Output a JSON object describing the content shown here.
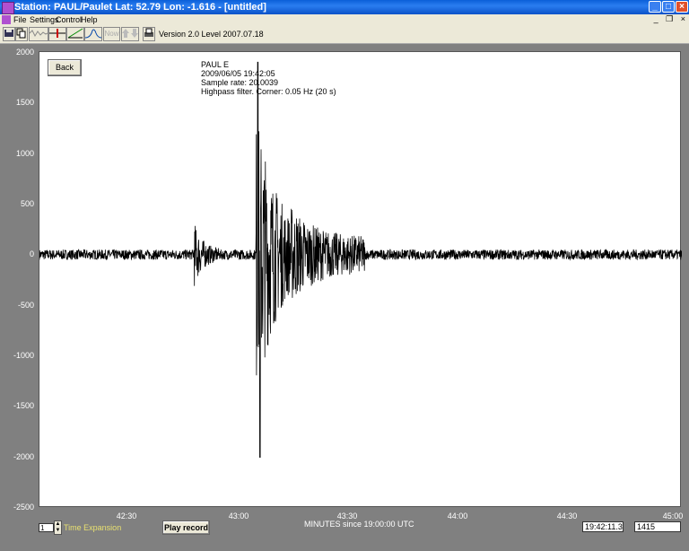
{
  "window": {
    "title": "Station: PAUL/Paulet  Lat: 52.79  Lon: -1.616  - [untitled]",
    "minimize": "_",
    "maximize": "□",
    "close": "×"
  },
  "menu": {
    "items": [
      "File",
      "Settings",
      "Control",
      "Help"
    ],
    "mdi_buttons": [
      "_",
      "❐",
      "×"
    ]
  },
  "toolbar": {
    "now_label": "Now",
    "version": "Version 2.0 Level 2007.07.18"
  },
  "plot": {
    "back_label": "Back",
    "info": {
      "station": "PAUL  E",
      "datetime": "2009/06/05 19:42:05",
      "sample_rate": "Sample rate: 20.0039",
      "filter": "Highpass filter. Corner: 0.05 Hz (20 s)"
    }
  },
  "chart_data": {
    "type": "line",
    "title": "",
    "xlabel": "MINUTES since 19:00:00 UTC",
    "ylabel": "",
    "ylim": [
      -2500,
      2000
    ],
    "yticks": [
      "2000",
      "1500",
      "1000",
      "500",
      "0",
      "-500",
      "-1000",
      "-1500",
      "-2000",
      "-2500"
    ],
    "xticks": [
      "42:30",
      "43:00",
      "43:30",
      "44:00",
      "44:30",
      "45:00"
    ],
    "grid": false,
    "series": [
      {
        "color": "#000000",
        "noise_amplitude": 50,
        "events": [
          {
            "minute": 42.72,
            "peak": 300
          },
          {
            "minute": 43.02,
            "peak": 1900
          },
          {
            "minute": 43.03,
            "peak": -2000
          }
        ]
      }
    ]
  },
  "bottom": {
    "time_expansion_value": "1",
    "time_expansion_label": "Time Expansion",
    "play_label": "Play record",
    "time_readout": "19:42:11.3",
    "count_readout": "1415"
  }
}
